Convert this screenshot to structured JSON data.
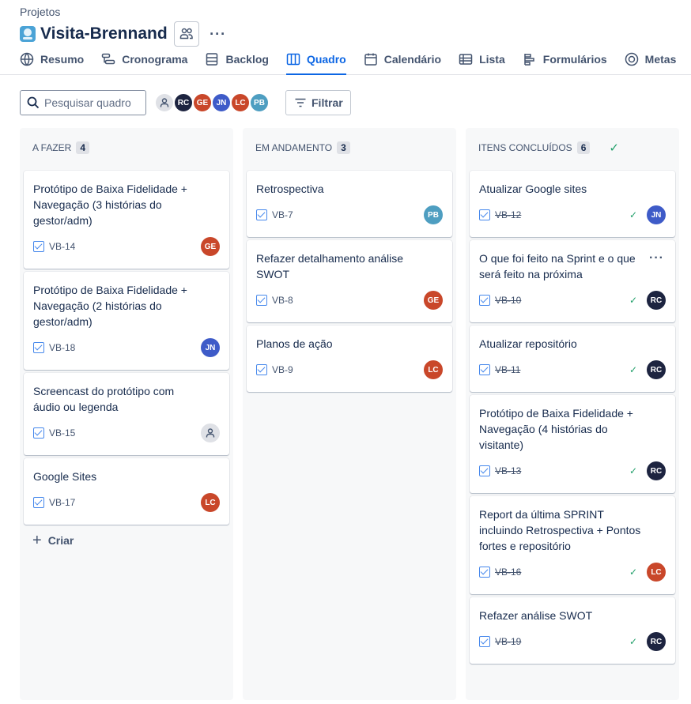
{
  "breadcrumb": "Projetos",
  "project": {
    "title": "Visita-Brennand",
    "more": "···"
  },
  "tabs": [
    {
      "label": "Resumo",
      "icon": "globe-icon"
    },
    {
      "label": "Cronograma",
      "icon": "timeline-icon"
    },
    {
      "label": "Backlog",
      "icon": "backlog-icon"
    },
    {
      "label": "Quadro",
      "icon": "board-icon",
      "active": true
    },
    {
      "label": "Calendário",
      "icon": "calendar-icon"
    },
    {
      "label": "Lista",
      "icon": "list-icon"
    },
    {
      "label": "Formulários",
      "icon": "forms-icon"
    },
    {
      "label": "Metas",
      "icon": "goals-icon"
    }
  ],
  "toolbar": {
    "search_placeholder": "Pesquisar quadro",
    "filter_label": "Filtrar",
    "avatars": [
      {
        "initials": "",
        "color": "#dfe1e6"
      },
      {
        "initials": "RC",
        "color": "#1d2440"
      },
      {
        "initials": "GE",
        "color": "#c9472a"
      },
      {
        "initials": "JN",
        "color": "#3e5bc8"
      },
      {
        "initials": "LC",
        "color": "#c9472a"
      },
      {
        "initials": "PB",
        "color": "#4e9ec1"
      }
    ]
  },
  "columns": [
    {
      "title": "A FAZER",
      "count": "4",
      "cards": [
        {
          "title": "Protótipo de Baixa Fidelidade + Navegação (3 histórias do gestor/adm)",
          "key": "VB-14",
          "assignee": "GE",
          "color": "#c9472a"
        },
        {
          "title": "Protótipo de Baixa Fidelidade + Navegação (2 histórias do gestor/adm)",
          "key": "VB-18",
          "assignee": "JN",
          "color": "#3e5bc8"
        },
        {
          "title": "Screencast do protótipo com áudio ou legenda",
          "key": "VB-15",
          "assignee": "",
          "color": "#dfe1e6"
        },
        {
          "title": "Google Sites",
          "key": "VB-17",
          "assignee": "LC",
          "color": "#c9472a"
        }
      ],
      "create_label": "Criar"
    },
    {
      "title": "EM ANDAMENTO",
      "count": "3",
      "cards": [
        {
          "title": "Retrospectiva",
          "key": "VB-7",
          "assignee": "PB",
          "color": "#4e9ec1"
        },
        {
          "title": "Refazer detalhamento análise SWOT",
          "key": "VB-8",
          "assignee": "GE",
          "color": "#c9472a"
        },
        {
          "title": "Planos de ação",
          "key": "VB-9",
          "assignee": "LC",
          "color": "#c9472a"
        }
      ]
    },
    {
      "title": "ITENS CONCLUÍDOS",
      "count": "6",
      "cards": [
        {
          "title": "Atualizar Google sites",
          "key": "VB-12",
          "assignee": "JN",
          "color": "#3e5bc8"
        },
        {
          "title": "O que foi feito na Sprint e o que será feito na próxima",
          "key": "VB-10",
          "assignee": "RC",
          "color": "#1d2440"
        },
        {
          "title": "Atualizar repositório",
          "key": "VB-11",
          "assignee": "RC",
          "color": "#1d2440"
        },
        {
          "title": "Protótipo de Baixa Fidelidade + Navegação (4 histórias do visitante)",
          "key": "VB-13",
          "assignee": "RC",
          "color": "#1d2440"
        },
        {
          "title": "Report da última SPRINT incluindo Retrospectiva + Pontos fortes e repositório",
          "key": "VB-16",
          "assignee": "LC",
          "color": "#c9472a"
        },
        {
          "title": "Refazer análise SWOT",
          "key": "VB-19",
          "assignee": "RC",
          "color": "#1d2440"
        }
      ]
    }
  ]
}
